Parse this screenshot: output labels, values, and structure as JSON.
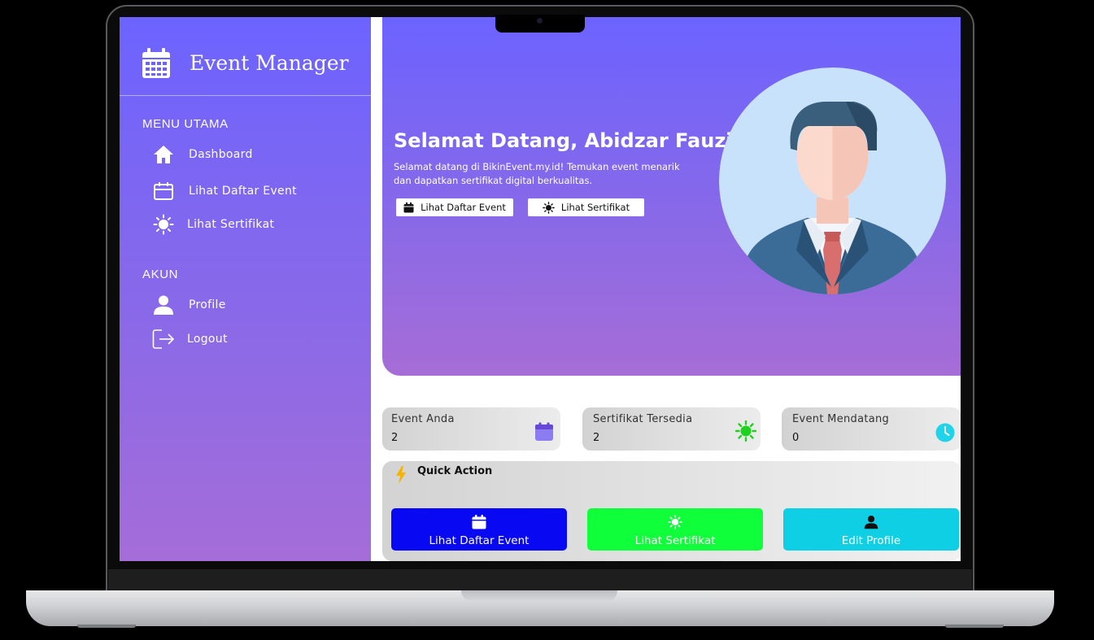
{
  "sidebar": {
    "brand": "Event Manager",
    "sections": [
      {
        "heading": "MENU UTAMA",
        "items": [
          {
            "label": "Dashboard",
            "icon": "home-icon"
          },
          {
            "label": "Lihat Daftar Event",
            "icon": "calendar-icon"
          },
          {
            "label": "Lihat Sertifikat",
            "icon": "sun-icon"
          }
        ]
      },
      {
        "heading": "AKUN",
        "items": [
          {
            "label": "Profile",
            "icon": "user-icon"
          },
          {
            "label": "Logout",
            "icon": "logout-icon"
          }
        ]
      }
    ]
  },
  "hero": {
    "title": "Selamat Datang, Abidzar Fauzi!",
    "subtitle": "Selamat datang di BikinEvent.my.id! Temukan event menarik dan dapatkan sertifikat digital berkualitas.",
    "buttons": [
      {
        "label": "Lihat Daftar Event",
        "icon": "calendar-icon"
      },
      {
        "label": "Lihat Sertifikat",
        "icon": "sun-icon"
      }
    ]
  },
  "stats": [
    {
      "label": "Event Anda",
      "value": "2",
      "icon": "calendar-icon",
      "color": "#7b61e8"
    },
    {
      "label": "Sertifikat Tersedia",
      "value": "2",
      "icon": "sun-icon",
      "color": "#1fd21f"
    },
    {
      "label": "Event Mendatang",
      "value": "0",
      "icon": "clock-icon",
      "color": "#1ed3ea"
    }
  ],
  "quick_action": {
    "title": "Quick Action",
    "buttons": [
      {
        "label": "Lihat Daftar Event",
        "icon": "calendar-icon",
        "color": "#0808f2"
      },
      {
        "label": "Lihat Sertifikat",
        "icon": "sun-icon",
        "color": "#0fff3a"
      },
      {
        "label": "Edit Profile",
        "icon": "user-icon",
        "color": "#0fcfe5"
      }
    ]
  },
  "colors": {
    "primary": "#6c63ff",
    "secondary": "#a66dd6"
  }
}
